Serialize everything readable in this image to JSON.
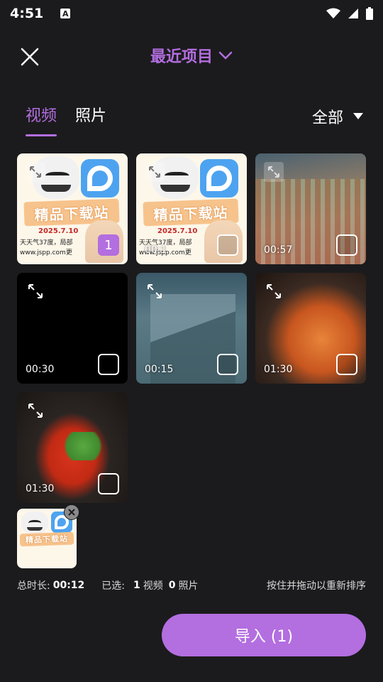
{
  "status_bar": {
    "time": "4:51",
    "notification_letter": "A"
  },
  "header": {
    "title": "最近项目"
  },
  "tabs": [
    {
      "label": "视频",
      "active": true
    },
    {
      "label": "照片",
      "active": false
    }
  ],
  "filter": {
    "label": "全部"
  },
  "ad_text": {
    "banner": "精品下载站",
    "date": "2025.7.10",
    "weather": "天天气37度，局部",
    "site": "www.jspp.com更"
  },
  "media": [
    {
      "duration": "",
      "selected_index": "1",
      "icon": "expand-icon",
      "kind": "ad"
    },
    {
      "duration": "00:1",
      "selected_index": "",
      "icon": "expand-icon",
      "kind": "ad"
    },
    {
      "duration": "00:57",
      "selected_index": "",
      "icon": "expand-icon",
      "kind": "town"
    },
    {
      "duration": "00:30",
      "selected_index": "",
      "icon": "expand-icon",
      "kind": "black"
    },
    {
      "duration": "00:15",
      "selected_index": "",
      "icon": "expand-icon",
      "kind": "street"
    },
    {
      "duration": "01:30",
      "selected_index": "",
      "icon": "expand-icon",
      "kind": "food1"
    },
    {
      "duration": "01:30",
      "selected_index": "",
      "icon": "expand-icon",
      "kind": "food2"
    }
  ],
  "selection": {
    "total_duration_label": "总时长:",
    "total_duration": "00:12",
    "selected_label": "已选:",
    "video_count": "1",
    "video_unit": "视频",
    "photo_count": "0",
    "photo_unit": "照片",
    "reorder_hint": "按住并拖动以重新排序"
  },
  "import_button": {
    "label": "导入 (1)"
  },
  "colors": {
    "accent": "#b36ee0",
    "background": "#1b1b1d"
  }
}
